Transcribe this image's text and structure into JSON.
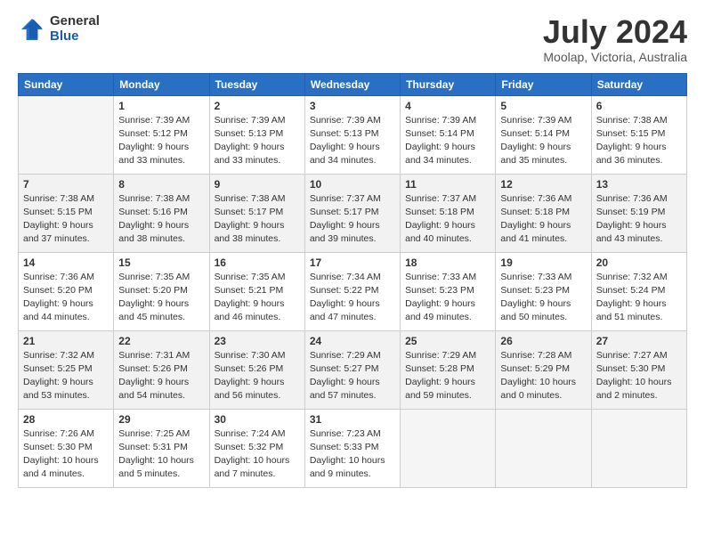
{
  "header": {
    "logo_general": "General",
    "logo_blue": "Blue",
    "month_title": "July 2024",
    "location": "Moolap, Victoria, Australia"
  },
  "days_of_week": [
    "Sunday",
    "Monday",
    "Tuesday",
    "Wednesday",
    "Thursday",
    "Friday",
    "Saturday"
  ],
  "weeks": [
    [
      {
        "day": "",
        "info": ""
      },
      {
        "day": "1",
        "info": "Sunrise: 7:39 AM\nSunset: 5:12 PM\nDaylight: 9 hours\nand 33 minutes."
      },
      {
        "day": "2",
        "info": "Sunrise: 7:39 AM\nSunset: 5:13 PM\nDaylight: 9 hours\nand 33 minutes."
      },
      {
        "day": "3",
        "info": "Sunrise: 7:39 AM\nSunset: 5:13 PM\nDaylight: 9 hours\nand 34 minutes."
      },
      {
        "day": "4",
        "info": "Sunrise: 7:39 AM\nSunset: 5:14 PM\nDaylight: 9 hours\nand 34 minutes."
      },
      {
        "day": "5",
        "info": "Sunrise: 7:39 AM\nSunset: 5:14 PM\nDaylight: 9 hours\nand 35 minutes."
      },
      {
        "day": "6",
        "info": "Sunrise: 7:38 AM\nSunset: 5:15 PM\nDaylight: 9 hours\nand 36 minutes."
      }
    ],
    [
      {
        "day": "7",
        "info": "Sunrise: 7:38 AM\nSunset: 5:15 PM\nDaylight: 9 hours\nand 37 minutes."
      },
      {
        "day": "8",
        "info": "Sunrise: 7:38 AM\nSunset: 5:16 PM\nDaylight: 9 hours\nand 38 minutes."
      },
      {
        "day": "9",
        "info": "Sunrise: 7:38 AM\nSunset: 5:17 PM\nDaylight: 9 hours\nand 38 minutes."
      },
      {
        "day": "10",
        "info": "Sunrise: 7:37 AM\nSunset: 5:17 PM\nDaylight: 9 hours\nand 39 minutes."
      },
      {
        "day": "11",
        "info": "Sunrise: 7:37 AM\nSunset: 5:18 PM\nDaylight: 9 hours\nand 40 minutes."
      },
      {
        "day": "12",
        "info": "Sunrise: 7:36 AM\nSunset: 5:18 PM\nDaylight: 9 hours\nand 41 minutes."
      },
      {
        "day": "13",
        "info": "Sunrise: 7:36 AM\nSunset: 5:19 PM\nDaylight: 9 hours\nand 43 minutes."
      }
    ],
    [
      {
        "day": "14",
        "info": "Sunrise: 7:36 AM\nSunset: 5:20 PM\nDaylight: 9 hours\nand 44 minutes."
      },
      {
        "day": "15",
        "info": "Sunrise: 7:35 AM\nSunset: 5:20 PM\nDaylight: 9 hours\nand 45 minutes."
      },
      {
        "day": "16",
        "info": "Sunrise: 7:35 AM\nSunset: 5:21 PM\nDaylight: 9 hours\nand 46 minutes."
      },
      {
        "day": "17",
        "info": "Sunrise: 7:34 AM\nSunset: 5:22 PM\nDaylight: 9 hours\nand 47 minutes."
      },
      {
        "day": "18",
        "info": "Sunrise: 7:33 AM\nSunset: 5:23 PM\nDaylight: 9 hours\nand 49 minutes."
      },
      {
        "day": "19",
        "info": "Sunrise: 7:33 AM\nSunset: 5:23 PM\nDaylight: 9 hours\nand 50 minutes."
      },
      {
        "day": "20",
        "info": "Sunrise: 7:32 AM\nSunset: 5:24 PM\nDaylight: 9 hours\nand 51 minutes."
      }
    ],
    [
      {
        "day": "21",
        "info": "Sunrise: 7:32 AM\nSunset: 5:25 PM\nDaylight: 9 hours\nand 53 minutes."
      },
      {
        "day": "22",
        "info": "Sunrise: 7:31 AM\nSunset: 5:26 PM\nDaylight: 9 hours\nand 54 minutes."
      },
      {
        "day": "23",
        "info": "Sunrise: 7:30 AM\nSunset: 5:26 PM\nDaylight: 9 hours\nand 56 minutes."
      },
      {
        "day": "24",
        "info": "Sunrise: 7:29 AM\nSunset: 5:27 PM\nDaylight: 9 hours\nand 57 minutes."
      },
      {
        "day": "25",
        "info": "Sunrise: 7:29 AM\nSunset: 5:28 PM\nDaylight: 9 hours\nand 59 minutes."
      },
      {
        "day": "26",
        "info": "Sunrise: 7:28 AM\nSunset: 5:29 PM\nDaylight: 10 hours\nand 0 minutes."
      },
      {
        "day": "27",
        "info": "Sunrise: 7:27 AM\nSunset: 5:30 PM\nDaylight: 10 hours\nand 2 minutes."
      }
    ],
    [
      {
        "day": "28",
        "info": "Sunrise: 7:26 AM\nSunset: 5:30 PM\nDaylight: 10 hours\nand 4 minutes."
      },
      {
        "day": "29",
        "info": "Sunrise: 7:25 AM\nSunset: 5:31 PM\nDaylight: 10 hours\nand 5 minutes."
      },
      {
        "day": "30",
        "info": "Sunrise: 7:24 AM\nSunset: 5:32 PM\nDaylight: 10 hours\nand 7 minutes."
      },
      {
        "day": "31",
        "info": "Sunrise: 7:23 AM\nSunset: 5:33 PM\nDaylight: 10 hours\nand 9 minutes."
      },
      {
        "day": "",
        "info": ""
      },
      {
        "day": "",
        "info": ""
      },
      {
        "day": "",
        "info": ""
      }
    ]
  ]
}
